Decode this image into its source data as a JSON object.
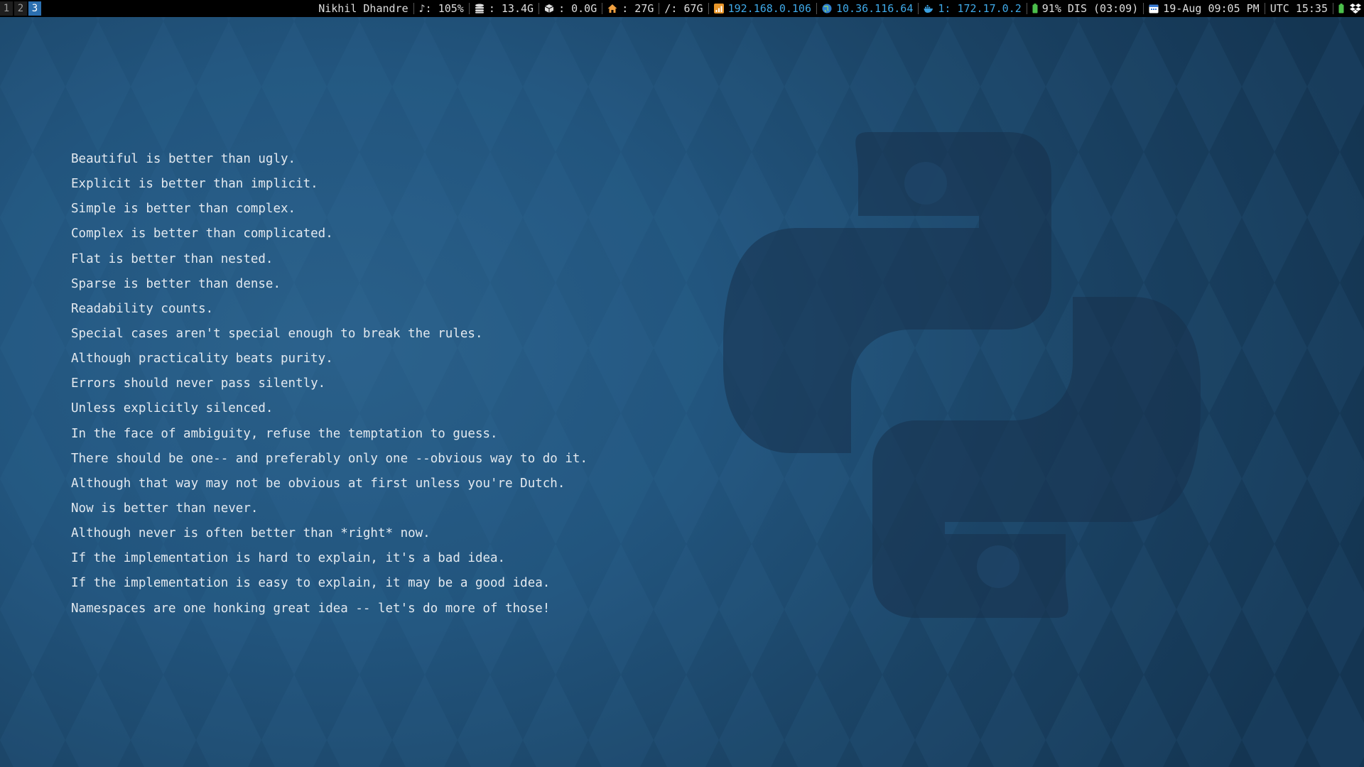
{
  "topbar": {
    "workspaces": [
      {
        "label": "1",
        "active": false
      },
      {
        "label": "2",
        "active": false
      },
      {
        "label": "3",
        "active": true
      }
    ],
    "user": "Nikhil Dhandre",
    "volume": {
      "icon": "music-note-icon",
      "text": "♪: 105%"
    },
    "memory": {
      "icon": "database-icon",
      "text": ": 13.4G"
    },
    "swap": {
      "icon": "box-icon",
      "text": ": 0.0G"
    },
    "home_disk": {
      "icon": "home-icon",
      "text": ": 27G"
    },
    "root_disk": {
      "text": "/: 67G"
    },
    "wifi": {
      "icon": "wifi-signal-icon",
      "text": "192.168.0.106"
    },
    "vpn": {
      "icon": "globe-icon",
      "text": "10.36.116.64"
    },
    "docker": {
      "icon": "docker-icon",
      "text": "1: 172.17.0.2"
    },
    "battery": {
      "icon": "battery-icon",
      "text": "91% DIS (03:09)"
    },
    "date": {
      "icon": "calendar-icon",
      "text": "19-Aug 09:05 PM"
    },
    "utc": {
      "text": "UTC 15:35"
    },
    "tray": [
      {
        "icon": "battery-tray-icon"
      },
      {
        "icon": "dropbox-icon"
      }
    ]
  },
  "colors": {
    "accent": "#2b6fb0",
    "link": "#3fa9e8",
    "text": "#e3e9ef"
  },
  "wallpaper": {
    "logo_icon": "python-logo-icon",
    "zen_lines": [
      "Beautiful is better than ugly.",
      "Explicit is better than implicit.",
      "Simple is better than complex.",
      "Complex is better than complicated.",
      "Flat is better than nested.",
      "Sparse is better than dense.",
      "Readability counts.",
      "Special cases aren't special enough to break the rules.",
      "Although practicality beats purity.",
      "Errors should never pass silently.",
      "Unless explicitly silenced.",
      "In the face of ambiguity, refuse the temptation to guess.",
      "There should be one-- and preferably only one --obvious way to do it.",
      "Although that way may not be obvious at first unless you're Dutch.",
      "Now is better than never.",
      "Although never is often better than *right* now.",
      "If the implementation is hard to explain, it's a bad idea.",
      "If the implementation is easy to explain, it may be a good idea.",
      "Namespaces are one honking great idea -- let's do more of those!"
    ]
  }
}
